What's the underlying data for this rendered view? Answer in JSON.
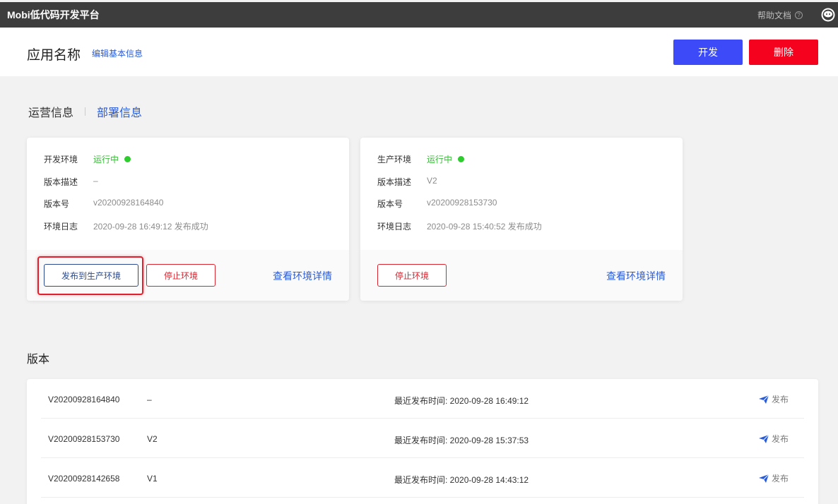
{
  "topbar": {
    "brand": "Mobi低代码开发平台",
    "help_label": "帮助文档",
    "help_icon": "question-circle",
    "avatar_icon": "user-avatar"
  },
  "header": {
    "app_name": "应用名称",
    "edit_link": "编辑基本信息",
    "develop_label": "开发",
    "delete_label": "删除"
  },
  "tabs": [
    {
      "label": "运营信息",
      "active": false
    },
    {
      "label": "部署信息",
      "active": true
    }
  ],
  "env_cards": [
    {
      "env_key": "开发环境",
      "env_status": "运行中",
      "desc_key": "版本描述",
      "desc_val": "–",
      "ver_key": "版本号",
      "ver_val": "v20200928164840",
      "log_key": "环境日志",
      "log_val": "2020-09-28 16:49:12 发布成功",
      "publish_label": "发布到生产环境",
      "stop_label": "停止环境",
      "detail_label": "查看环境详情"
    },
    {
      "env_key": "生产环境",
      "env_status": "运行中",
      "desc_key": "版本描述",
      "desc_val": "V2",
      "ver_key": "版本号",
      "ver_val": "v20200928153730",
      "log_key": "环境日志",
      "log_val": "2020-09-28 15:40:52 发布成功",
      "stop_label": "停止环境",
      "detail_label": "查看环境详情"
    }
  ],
  "versions": {
    "title": "版本",
    "rows": [
      {
        "id": "V20200928164840",
        "desc": "–",
        "time": "最近发布时间: 2020-09-28 16:49:12",
        "action": "发布"
      },
      {
        "id": "V20200928153730",
        "desc": "V2",
        "time": "最近发布时间: 2020-09-28 15:37:53",
        "action": "发布"
      },
      {
        "id": "V20200928142658",
        "desc": "V1",
        "time": "最近发布时间: 2020-09-28 14:43:12",
        "action": "发布"
      }
    ]
  },
  "colors": {
    "primary": "#3c4bf7",
    "danger": "#f5031e",
    "running": "#3cba3c",
    "link": "#2a5bd7"
  }
}
